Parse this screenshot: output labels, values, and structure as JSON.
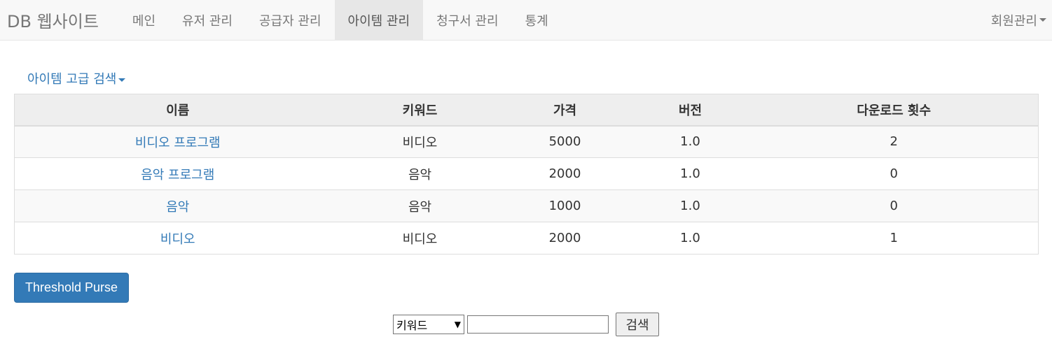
{
  "navbar": {
    "brand": "DB 웹사이트",
    "items": [
      {
        "label": "메인",
        "active": false
      },
      {
        "label": "유저 관리",
        "active": false
      },
      {
        "label": "공급자 관리",
        "active": false
      },
      {
        "label": "아이템 관리",
        "active": true
      },
      {
        "label": "청구서 관리",
        "active": false
      },
      {
        "label": "통계",
        "active": false
      }
    ],
    "right_menu": "회원관리"
  },
  "advanced_search": {
    "label": "아이템 고급 검색"
  },
  "table": {
    "headers": [
      "이름",
      "키워드",
      "가격",
      "버전",
      "다운로드 횟수"
    ],
    "rows": [
      {
        "name": "비디오 프로그램",
        "keyword": "비디오",
        "price": "5000",
        "version": "1.0",
        "downloads": "2"
      },
      {
        "name": "음악 프로그램",
        "keyword": "음악",
        "price": "2000",
        "version": "1.0",
        "downloads": "0"
      },
      {
        "name": "음악",
        "keyword": "음악",
        "price": "1000",
        "version": "1.0",
        "downloads": "0"
      },
      {
        "name": "비디오",
        "keyword": "비디오",
        "price": "2000",
        "version": "1.0",
        "downloads": "1"
      }
    ]
  },
  "threshold_button": {
    "label": "Threshold Purse"
  },
  "search": {
    "selected_option": "키워드",
    "input_value": "",
    "button_label": "검색"
  },
  "colors": {
    "link": "#337ab7",
    "primary": "#337ab7",
    "navbar_bg": "#f8f8f8"
  }
}
